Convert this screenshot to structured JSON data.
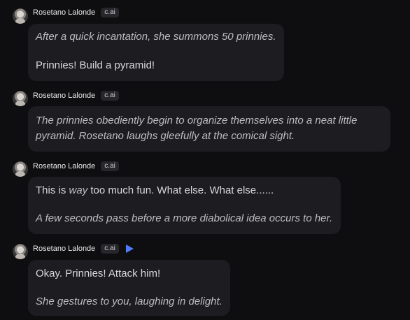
{
  "messages": [
    {
      "author": "Rosetano Lalonde",
      "badge": "c.ai",
      "paragraphs": [
        {
          "text": "After a quick incantation, she summons 50 prinnies."
        },
        {
          "text": "Prinnies! Build a pyramid!"
        }
      ]
    },
    {
      "author": "Rosetano Lalonde",
      "badge": "c.ai",
      "paragraphs": [
        {
          "text": "The prinnies obediently begin to organize themselves into a neat little"
        },
        {
          "text": "pyramid. Rosetano laughs gleefully at the comical sight."
        }
      ]
    },
    {
      "author": "Rosetano Lalonde",
      "badge": "c.ai",
      "paragraphs": [
        {
          "pre": "This is ",
          "em": "way",
          "post": " too much fun. What else. What else......"
        },
        {
          "text": "A few seconds pass before a more diabolical idea occurs to her."
        }
      ]
    },
    {
      "author": "Rosetano Lalonde",
      "badge": "c.ai",
      "play_icon": "play-icon",
      "paragraphs": [
        {
          "text": "Okay. Prinnies! Attack him!"
        },
        {
          "text": "She gestures to you, laughing in delight."
        }
      ]
    }
  ],
  "colors": {
    "background": "#0e0e10",
    "bubble": "#1d1d21",
    "play_accent": "#4f7cff"
  }
}
